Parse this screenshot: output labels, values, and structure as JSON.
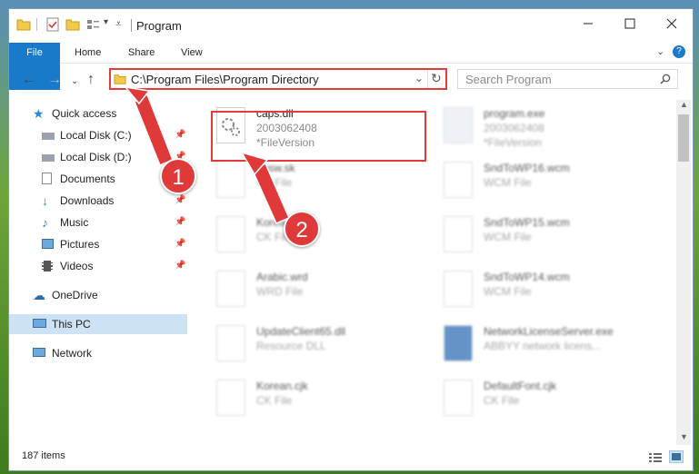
{
  "window": {
    "title": "Program"
  },
  "ribbon": {
    "tabs": [
      "File",
      "Home",
      "Share",
      "View"
    ]
  },
  "nav": {
    "address": "C:\\Program Files\\Program Directory",
    "search_placeholder": "Search Program"
  },
  "sidebar": {
    "items": [
      {
        "label": "Quick access",
        "icon": "star-icon"
      },
      {
        "label": "Local Disk (C:)",
        "icon": "drive-icon",
        "pinned": true
      },
      {
        "label": "Local Disk (D:)",
        "icon": "drive-icon",
        "pinned": true
      },
      {
        "label": "Documents",
        "icon": "documents-icon",
        "pinned": true
      },
      {
        "label": "Downloads",
        "icon": "download-icon",
        "pinned": true
      },
      {
        "label": "Music",
        "icon": "music-icon",
        "pinned": true
      },
      {
        "label": "Pictures",
        "icon": "pictures-icon",
        "pinned": true
      },
      {
        "label": "Videos",
        "icon": "videos-icon",
        "pinned": true
      },
      {
        "label": "OneDrive",
        "icon": "cloud-icon"
      },
      {
        "label": "This PC",
        "icon": "computer-icon",
        "selected": true
      },
      {
        "label": "Network",
        "icon": "network-icon"
      }
    ]
  },
  "files": [
    {
      "name": "caps.dll",
      "line2": "2003062408",
      "line3": "*FileVersion",
      "highlight": true
    },
    {
      "name": "program.exe",
      "line2": "2003062408",
      "line3": "*FileVersion"
    },
    {
      "name": "dbsw.sk",
      "line2": "CK File"
    },
    {
      "name": "SndToWP16.wcm",
      "line2": "WCM File"
    },
    {
      "name": "Korean.cjk",
      "line2": "CK File"
    },
    {
      "name": "SndToWP15.wcm",
      "line2": "WCM File"
    },
    {
      "name": "Arabic.wrd",
      "line2": "WRD File"
    },
    {
      "name": "SndToWP14.wcm",
      "line2": "WCM File"
    },
    {
      "name": "UpdateClient65.dll",
      "line2": "Resource DLL"
    },
    {
      "name": "NetworkLicenseServer.exe",
      "line2": "ABBYY network licens..."
    },
    {
      "name": "Korean.cjk",
      "line2": "CK File"
    },
    {
      "name": "DefaultFont.cjk",
      "line2": "CK File"
    }
  ],
  "status": {
    "count": "187 items"
  },
  "callouts": [
    "1",
    "2"
  ],
  "colors": {
    "accent": "#1979ca",
    "highlight": "#e23b3b",
    "selection": "#cde2f4"
  }
}
